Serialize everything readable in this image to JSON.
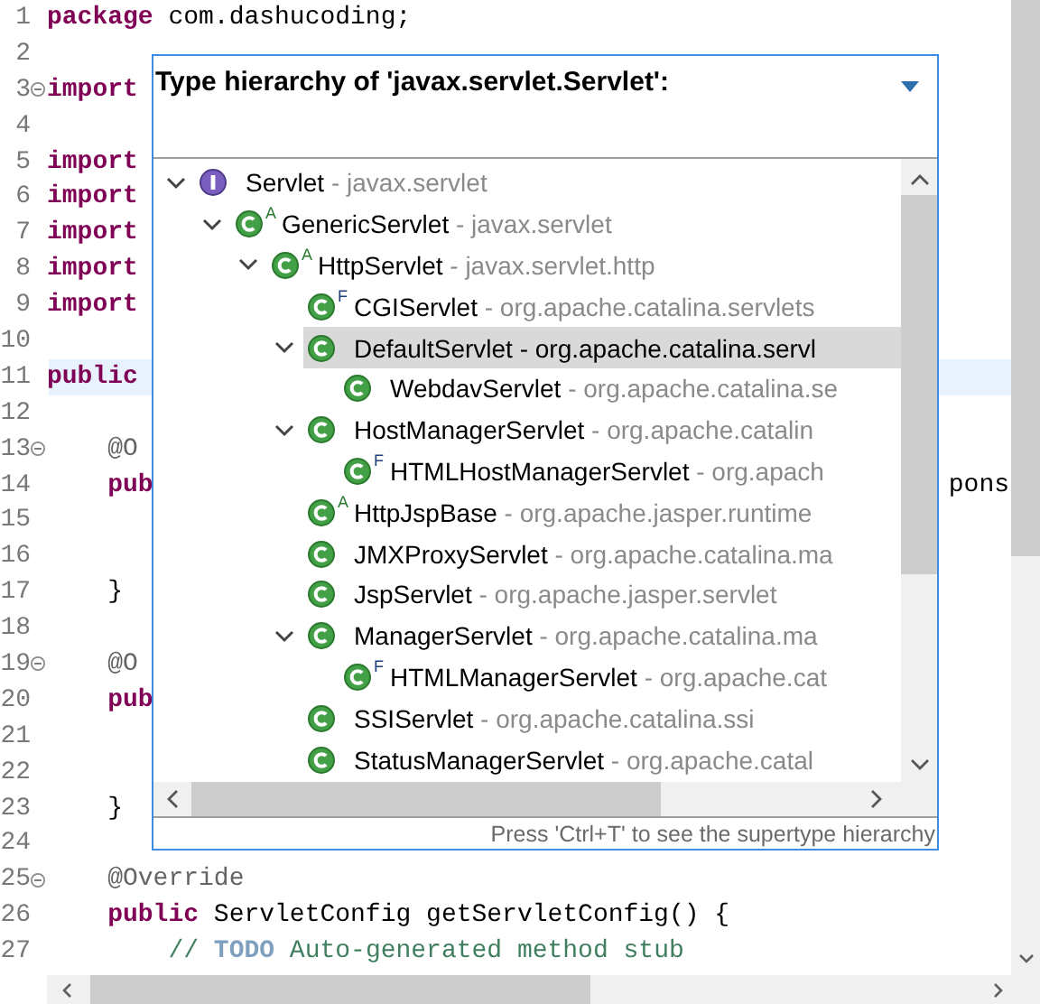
{
  "editor": {
    "lines": [
      {
        "number": "1",
        "current": false,
        "tokens": [
          {
            "kind": "keyword",
            "text": "package"
          },
          {
            "kind": "plain",
            "text": " com.dashucoding;"
          }
        ]
      },
      {
        "number": "2",
        "current": false
      },
      {
        "number": "3",
        "current": false,
        "folded": false,
        "tokens": [
          {
            "kind": "keyword",
            "text": "import"
          }
        ]
      },
      {
        "number": "4",
        "current": false
      },
      {
        "number": "5",
        "current": false,
        "tokens": [
          {
            "kind": "keyword",
            "text": "import"
          }
        ]
      },
      {
        "number": "6",
        "current": false,
        "tokens": [
          {
            "kind": "keyword",
            "text": "import"
          }
        ]
      },
      {
        "number": "7",
        "current": false,
        "tokens": [
          {
            "kind": "keyword",
            "text": "import"
          }
        ]
      },
      {
        "number": "8",
        "current": false,
        "tokens": [
          {
            "kind": "keyword",
            "text": "import"
          }
        ]
      },
      {
        "number": "9",
        "current": false,
        "tokens": [
          {
            "kind": "keyword",
            "text": "import"
          }
        ]
      },
      {
        "number": "10",
        "current": false
      },
      {
        "number": "11",
        "current": true,
        "tokens": [
          {
            "kind": "keyword",
            "text": "public"
          }
        ]
      },
      {
        "number": "12",
        "current": false
      },
      {
        "number": "13",
        "current": false,
        "folded": false,
        "tokens": [
          {
            "kind": "annotation",
            "text": "    @O"
          }
        ]
      },
      {
        "number": "14",
        "current": false,
        "tokens": [
          {
            "kind": "keyword",
            "text": "    pub"
          }
        ],
        "tail": "pons"
      },
      {
        "number": "15",
        "current": false
      },
      {
        "number": "16",
        "current": false
      },
      {
        "number": "17",
        "current": false,
        "tokens": [
          {
            "kind": "plain",
            "text": "    }"
          }
        ]
      },
      {
        "number": "18",
        "current": false
      },
      {
        "number": "19",
        "current": false,
        "folded": false,
        "tokens": [
          {
            "kind": "annotation",
            "text": "    @O"
          }
        ]
      },
      {
        "number": "20",
        "current": false,
        "tokens": [
          {
            "kind": "keyword",
            "text": "    pub"
          }
        ]
      },
      {
        "number": "21",
        "current": false
      },
      {
        "number": "22",
        "current": false
      },
      {
        "number": "23",
        "current": false,
        "tokens": [
          {
            "kind": "plain",
            "text": "    }"
          }
        ]
      },
      {
        "number": "24",
        "current": false
      },
      {
        "number": "25",
        "current": false,
        "folded": false,
        "tokens": [
          {
            "kind": "annotation",
            "text": "    @Override"
          }
        ]
      },
      {
        "number": "26",
        "current": false,
        "tokens": [
          {
            "kind": "keyword",
            "text": "    public"
          },
          {
            "kind": "plain",
            "text": " ServletConfig getServletConfig() {"
          }
        ]
      },
      {
        "number": "27",
        "current": false,
        "tokens": [
          {
            "kind": "comment",
            "text": "        // "
          },
          {
            "kind": "task",
            "text": "TODO"
          },
          {
            "kind": "comment",
            "text": " Auto-generated method stub"
          }
        ]
      }
    ]
  },
  "popup": {
    "title": "Type hierarchy of 'javax.servlet.Servlet':",
    "tree": [
      {
        "kind": "interface",
        "name": "Servlet",
        "qualifier": "- javax.servlet",
        "selected": false,
        "expanded": true,
        "children": [
          {
            "kind": "class",
            "modifier": "A",
            "name": "GenericServlet",
            "qualifier": "- javax.servlet",
            "selected": false,
            "expanded": true,
            "children": [
              {
                "kind": "class",
                "modifier": "A",
                "name": "HttpServlet",
                "qualifier": "- javax.servlet.http",
                "selected": false,
                "expanded": true,
                "children": [
                  {
                    "kind": "class",
                    "modifier": "F",
                    "name": "CGIServlet",
                    "qualifier": "- org.apache.catalina.servlets",
                    "selected": false
                  },
                  {
                    "kind": "class",
                    "name": "DefaultServlet",
                    "qualifier": "- org.apache.catalina.servl",
                    "selected": true,
                    "expanded": true,
                    "children": [
                      {
                        "kind": "class",
                        "name": "WebdavServlet",
                        "qualifier": "- org.apache.catalina.se",
                        "selected": false
                      }
                    ]
                  },
                  {
                    "kind": "class",
                    "name": "HostManagerServlet",
                    "qualifier": "- org.apache.catalin",
                    "selected": false,
                    "expanded": true,
                    "children": [
                      {
                        "kind": "class",
                        "modifier": "F",
                        "name": "HTMLHostManagerServlet",
                        "qualifier": "- org.apach",
                        "selected": false
                      }
                    ]
                  },
                  {
                    "kind": "class",
                    "modifier": "A",
                    "name": "HttpJspBase",
                    "qualifier": "- org.apache.jasper.runtime",
                    "selected": false
                  },
                  {
                    "kind": "class",
                    "name": "JMXProxyServlet",
                    "qualifier": "- org.apache.catalina.ma",
                    "selected": false
                  },
                  {
                    "kind": "class",
                    "name": "JspServlet",
                    "qualifier": "- org.apache.jasper.servlet",
                    "selected": false
                  },
                  {
                    "kind": "class",
                    "name": "ManagerServlet",
                    "qualifier": "- org.apache.catalina.ma",
                    "selected": false,
                    "expanded": true,
                    "children": [
                      {
                        "kind": "class",
                        "modifier": "F",
                        "name": "HTMLManagerServlet",
                        "qualifier": "- org.apache.cat",
                        "selected": false
                      }
                    ]
                  },
                  {
                    "kind": "class",
                    "name": "SSIServlet",
                    "qualifier": "- org.apache.catalina.ssi",
                    "selected": false
                  },
                  {
                    "kind": "class",
                    "name": "StatusManagerServlet",
                    "qualifier": "- org.apache.catal",
                    "selected": false
                  }
                ]
              }
            ]
          }
        ]
      }
    ],
    "footer": "Press 'Ctrl+T' to see the supertype hierarchy"
  }
}
